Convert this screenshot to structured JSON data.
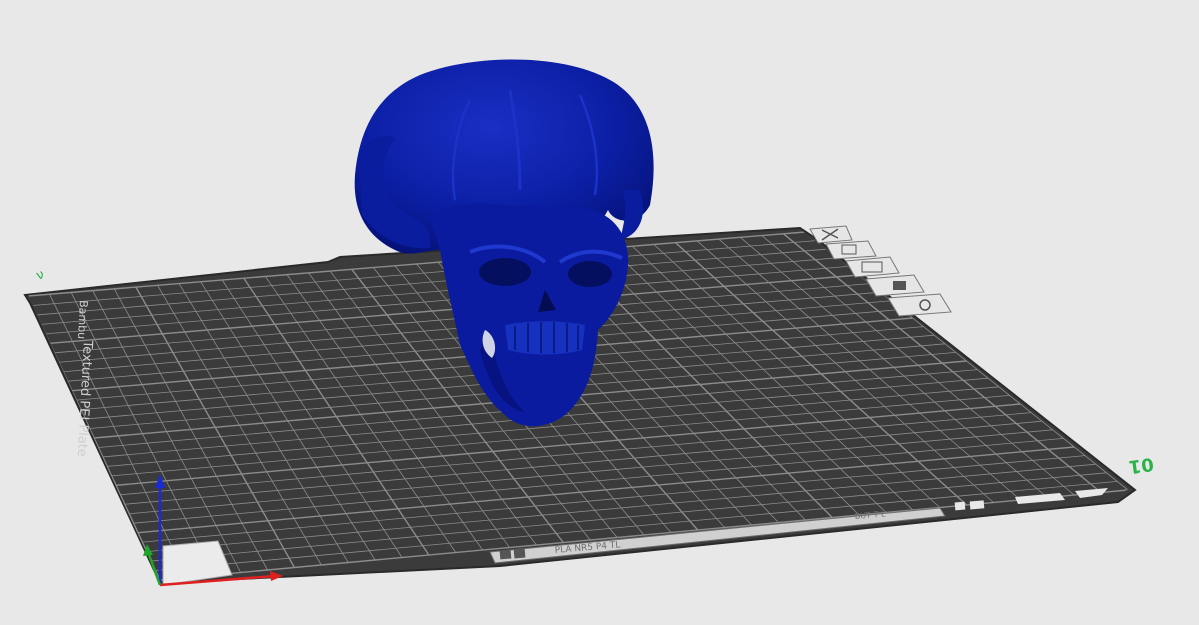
{
  "viewport": {
    "plate_label": "Textured PEI Plate",
    "plate_brand": "Bambu",
    "plate_number": "01",
    "plate_serial": "PLA NR5 P4 TL",
    "plate_code": "BUT T L",
    "plate_corner_mark": "ν",
    "model_name": "skull-model",
    "colors": {
      "background": "#e8e8e8",
      "plate": "#3b3b3b",
      "plate_edge": "#2a2a2a",
      "grid": "#8c8c8c",
      "model": "#0a1a9e",
      "plate_number_color": "#2bb34a",
      "axis_x": "#e02020",
      "axis_y": "#1fa52a",
      "axis_z": "#1a2bd6"
    },
    "plate_icons": [
      "close-icon",
      "copy-icon",
      "layout-icon",
      "lock-icon",
      "settings-icon"
    ]
  }
}
